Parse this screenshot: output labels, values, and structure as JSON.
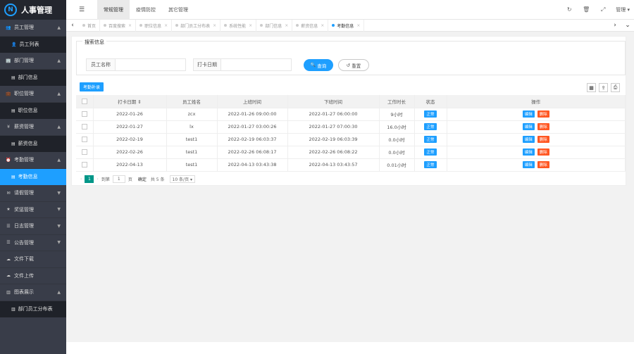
{
  "app": {
    "title": "人事管理",
    "logo_glyph": "N"
  },
  "sidebar": {
    "items": [
      {
        "type": "group",
        "label": "员工管理",
        "icon": "users-icon",
        "glyph": "👥",
        "arrow": "▲"
      },
      {
        "type": "sub",
        "label": "员工列表",
        "icon": "user-icon",
        "glyph": "👤",
        "active": false
      },
      {
        "type": "group",
        "label": "部门管理",
        "icon": "building-icon",
        "glyph": "🏢",
        "arrow": "▲"
      },
      {
        "type": "sub",
        "label": "部门信息",
        "icon": "list-icon",
        "glyph": "▤",
        "active": false
      },
      {
        "type": "group",
        "label": "职位管理",
        "icon": "briefcase-icon",
        "glyph": "💼",
        "arrow": "▲"
      },
      {
        "type": "sub",
        "label": "职位信息",
        "icon": "list-icon",
        "glyph": "▤",
        "active": false
      },
      {
        "type": "group",
        "label": "薪资管理",
        "icon": "money-icon",
        "glyph": "¥",
        "arrow": "▲"
      },
      {
        "type": "sub",
        "label": "薪资信息",
        "icon": "list-icon",
        "glyph": "▤",
        "active": false
      },
      {
        "type": "group",
        "label": "考勤管理",
        "icon": "clock-icon",
        "glyph": "⏰",
        "arrow": "▲"
      },
      {
        "type": "sub",
        "label": "考勤信息",
        "icon": "list-icon",
        "glyph": "▤",
        "active": true
      },
      {
        "type": "group",
        "label": "请假管理",
        "icon": "leave-icon",
        "glyph": "✉",
        "arrow": "▼"
      },
      {
        "type": "group",
        "label": "奖惩管理",
        "icon": "award-icon",
        "glyph": "★",
        "arrow": "▼"
      },
      {
        "type": "group",
        "label": "日志管理",
        "icon": "log-icon",
        "glyph": "☰",
        "arrow": "▼"
      },
      {
        "type": "group",
        "label": "公告管理",
        "icon": "notice-icon",
        "glyph": "☰",
        "arrow": "▼"
      },
      {
        "type": "group",
        "label": "文件下载",
        "icon": "download-icon",
        "glyph": "☁",
        "arrow": ""
      },
      {
        "type": "group",
        "label": "文件上传",
        "icon": "upload-icon",
        "glyph": "☁",
        "arrow": ""
      },
      {
        "type": "group",
        "label": "图表展示",
        "icon": "chart-icon",
        "glyph": "▥",
        "arrow": "▲"
      },
      {
        "type": "sub",
        "label": "部门员工分布表",
        "icon": "bar-chart-icon",
        "glyph": "▥",
        "active": false
      }
    ]
  },
  "topbar": {
    "menu_glyph": "☰",
    "tabs": [
      {
        "label": "常规管理",
        "active": true
      },
      {
        "label": "疫情防控",
        "active": false
      },
      {
        "label": "其它管理",
        "active": false
      }
    ],
    "icons": [
      {
        "name": "refresh-icon",
        "glyph": "↻"
      },
      {
        "name": "trash-icon",
        "glyph": "🗑"
      },
      {
        "name": "fullscreen-icon",
        "glyph": "⤢"
      }
    ],
    "user": "管理 ▾"
  },
  "tabsbar": {
    "left": "‹",
    "right": "›",
    "down": "⌄",
    "close": "×",
    "tabs": [
      {
        "label": "首页",
        "closable": false,
        "active": false
      },
      {
        "label": "百度搜索",
        "closable": true,
        "active": false
      },
      {
        "label": "职位信息",
        "closable": true,
        "active": false
      },
      {
        "label": "部门员工分布表",
        "closable": true,
        "active": false
      },
      {
        "label": "系统性能",
        "closable": true,
        "active": false
      },
      {
        "label": "部门信息",
        "closable": true,
        "active": false
      },
      {
        "label": "薪资信息",
        "closable": true,
        "active": false
      },
      {
        "label": "考勤信息",
        "closable": true,
        "active": true
      }
    ]
  },
  "search": {
    "legend": "搜索信息",
    "name_label": "员工名称",
    "name_value": "",
    "date_label": "打卡日期",
    "date_value": "",
    "search_btn": "查询",
    "search_glyph": "🔍",
    "reset_btn": "重置",
    "reset_glyph": "↺"
  },
  "toolbar": {
    "add_btn": "考勤补录",
    "tools": [
      {
        "name": "columns-icon",
        "glyph": "▦"
      },
      {
        "name": "export-icon",
        "glyph": "⇪"
      },
      {
        "name": "print-icon",
        "glyph": "⎙"
      }
    ]
  },
  "table": {
    "headers": [
      "",
      "打卡日期 ⇕",
      "员工姓名",
      "上班时间",
      "下班时间",
      "工作时长",
      "状态",
      "操作"
    ],
    "rows": [
      {
        "date": "2022-01-26",
        "name": "zcx",
        "in": "2022-01-26 09:00:00",
        "out": "2022-01-27 06:00:00",
        "hours": "9小时",
        "status": "正常"
      },
      {
        "date": "2022-01-27",
        "name": "lx",
        "in": "2022-01-27 03:00:26",
        "out": "2022-01-27 07:00:30",
        "hours": "16.0小时",
        "status": "正常"
      },
      {
        "date": "2022-02-19",
        "name": "test1",
        "in": "2022-02-19 06:03:37",
        "out": "2022-02-19 06:03:39",
        "hours": "0.0小时",
        "status": "正常"
      },
      {
        "date": "2022-02-26",
        "name": "test1",
        "in": "2022-02-26 06:08:17",
        "out": "2022-02-26 06:08:22",
        "hours": "0.0小时",
        "status": "正常"
      },
      {
        "date": "2022-04-13",
        "name": "test1",
        "in": "2022-04-13 03:43:38",
        "out": "2022-04-13 03:43:57",
        "hours": "0.01小时",
        "status": "正常"
      }
    ],
    "edit_label": "编辑",
    "delete_label": "删除"
  },
  "pager": {
    "prev": "‹",
    "next": "›",
    "current": "1",
    "goto_label": "到第",
    "goto_value": "1",
    "page_unit": "页",
    "confirm": "确定",
    "total": "共 5 条",
    "per_page": "10 条/页 ▾"
  }
}
